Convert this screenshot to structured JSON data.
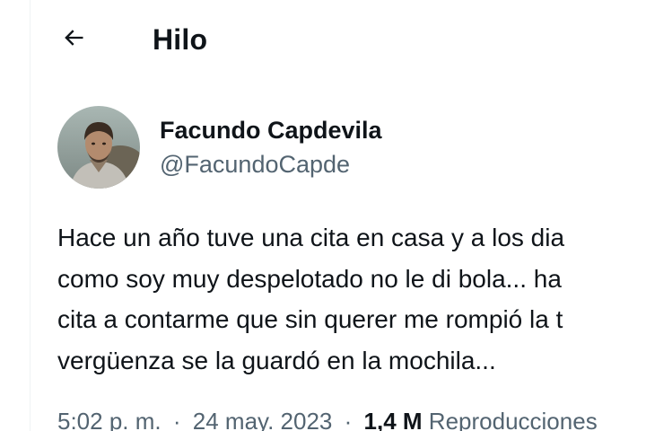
{
  "header": {
    "back_icon": "arrow-left-icon",
    "title": "Hilo"
  },
  "tweet": {
    "author": {
      "display_name": "Facundo Capdevila",
      "handle": "@FacundoCapde"
    },
    "text_lines": [
      "Hace un año tuve una cita en casa y a los dia",
      "como soy muy despelotado no le di bola... ha",
      "cita a contarme que sin querer me rompió la t",
      "vergüenza se la guardó en la mochila..."
    ],
    "meta": {
      "time": "5:02 p. m.",
      "separator": "·",
      "date": "24 may. 2023",
      "views_count": "1,4 M",
      "views_label": "Reproducciones"
    }
  },
  "colors": {
    "text_primary": "#0f1419",
    "text_secondary": "#536471",
    "divider": "#eff3f4"
  }
}
